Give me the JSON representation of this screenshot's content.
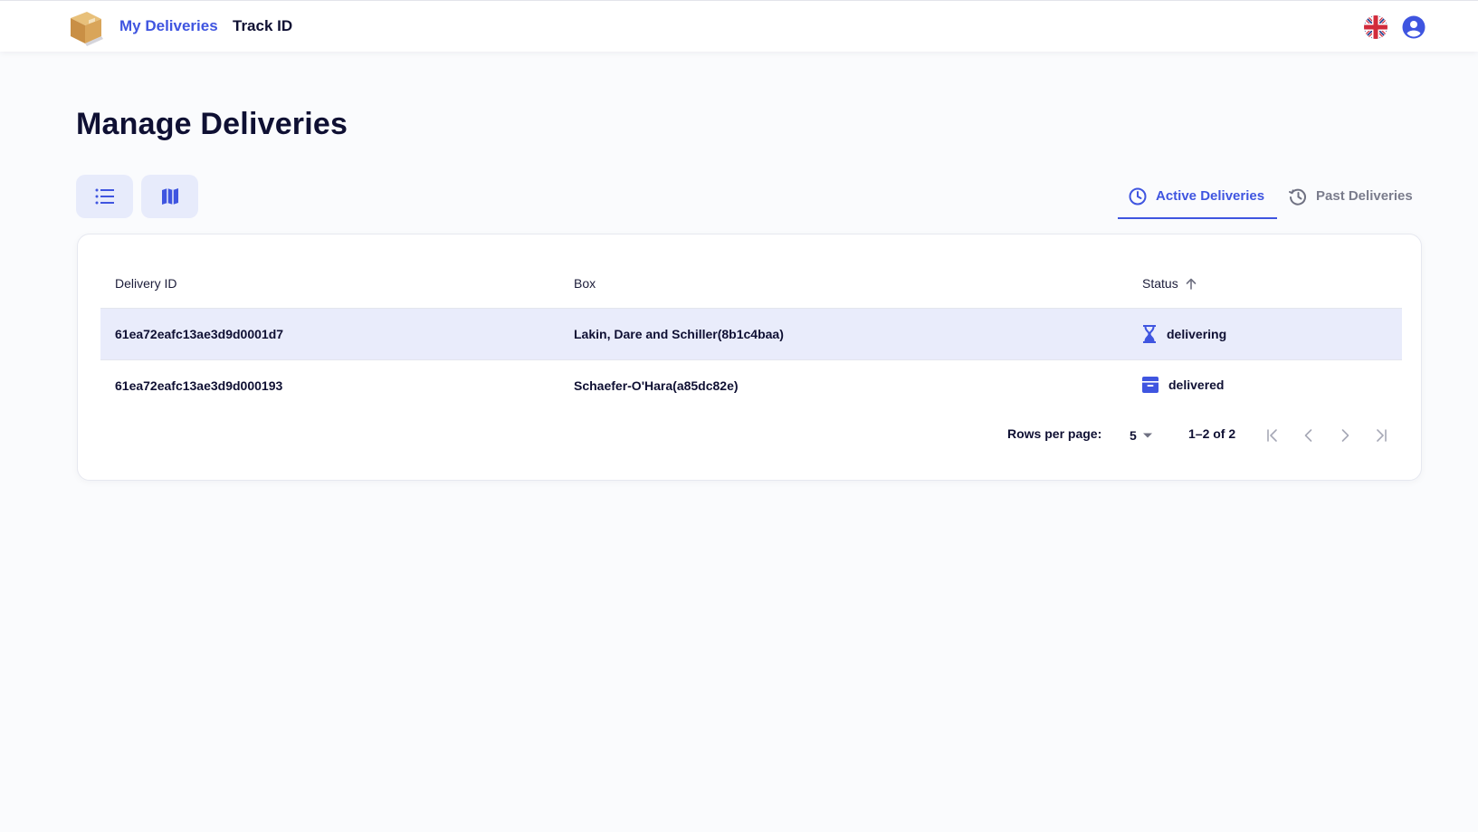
{
  "nav": {
    "my_deliveries": "My Deliveries",
    "track_id": "Track ID",
    "logo_icon": "package-box-icon",
    "language_icon": "uk-flag-icon",
    "account_icon": "account-circle-icon"
  },
  "page": {
    "title": "Manage Deliveries"
  },
  "view_toggle": {
    "list_icon": "list-icon",
    "map_icon": "map-icon"
  },
  "tabs": [
    {
      "label": "Active Deliveries",
      "icon": "clock-icon",
      "active": true
    },
    {
      "label": "Past Deliveries",
      "icon": "history-icon",
      "active": false
    }
  ],
  "table": {
    "columns": [
      "Delivery ID",
      "Box",
      "Status"
    ],
    "sort_icon": "arrow-up-icon",
    "rows": [
      {
        "id": "61ea72eafc13ae3d9d0001d7",
        "box": "Lakin, Dare and Schiller(8b1c4baa)",
        "status": "delivering",
        "status_icon": "hourglass-icon"
      },
      {
        "id": "61ea72eafc13ae3d9d000193",
        "box": "Schaefer-O'Hara(a85dc82e)",
        "status": "delivered",
        "status_icon": "archive-icon"
      }
    ]
  },
  "pagination": {
    "rows_per_page_label": "Rows per page:",
    "rows_per_page_value": "5",
    "range": "1–2 of 2"
  },
  "colors": {
    "accent": "#3f55e0",
    "text": "#0f1033",
    "background": "#fafbfd",
    "selected_row": "#e9ecfb"
  }
}
